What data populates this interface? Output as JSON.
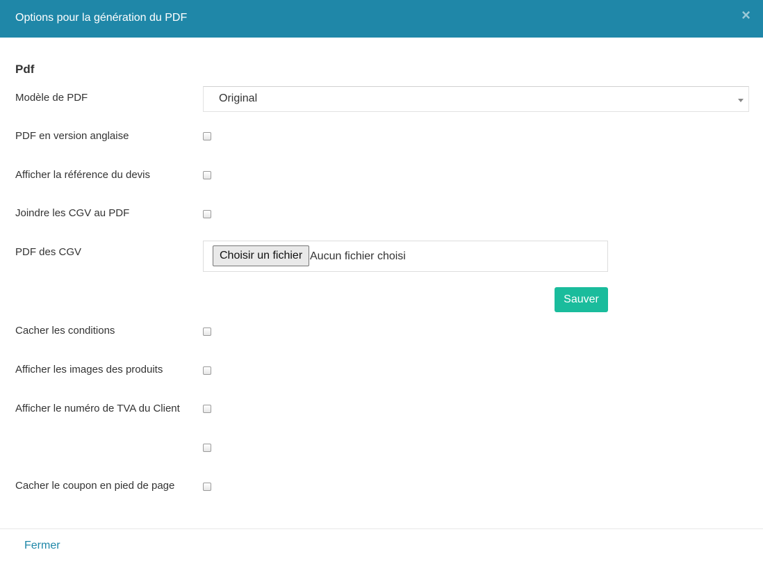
{
  "modal": {
    "title": "Options pour la génération du PDF",
    "close_symbol": "×",
    "header_color": "#1f87a8"
  },
  "section": {
    "title": "Pdf"
  },
  "fields": {
    "pdf_model": {
      "label": "Modèle de PDF",
      "selected": "Original"
    },
    "english_version": {
      "label": "PDF en version anglaise",
      "checked": false
    },
    "show_quote_reference": {
      "label": "Afficher la référence du devis",
      "checked": false
    },
    "attach_cgv": {
      "label": "Joindre les CGV au PDF",
      "checked": false
    },
    "cgv_pdf": {
      "label": "PDF des CGV",
      "button_label": "Choisir un fichier",
      "status": "Aucun fichier choisi"
    },
    "save_button": {
      "label": "Sauver",
      "color": "#1abc9c"
    },
    "hide_conditions": {
      "label": "Cacher les conditions",
      "checked": false
    },
    "show_product_images": {
      "label": "Afficher les images des produits",
      "checked": false
    },
    "show_client_vat": {
      "label": "Afficher le numéro de TVA du Client",
      "checked": false
    },
    "unlabeled_option": {
      "label": "",
      "checked": false
    },
    "hide_footer_coupon": {
      "label": "Cacher le coupon en pied de page",
      "checked": false
    }
  },
  "footer": {
    "close_label": "Fermer"
  }
}
